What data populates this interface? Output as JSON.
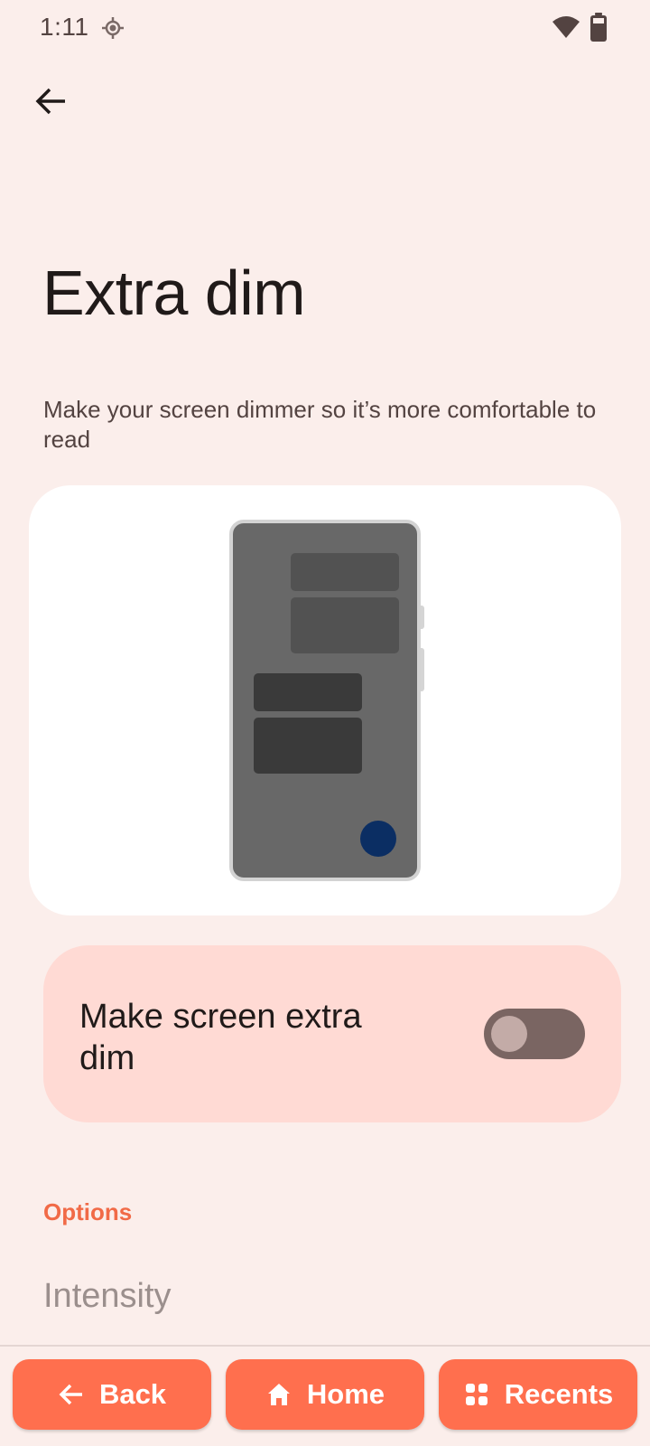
{
  "status_bar": {
    "time": "1:11",
    "icons": [
      "location-icon",
      "wifi-icon",
      "battery-icon"
    ]
  },
  "header": {
    "back_icon": "arrow-left-icon"
  },
  "page": {
    "title": "Extra dim",
    "description": "Make your screen dimmer so it’s more comfortable to read"
  },
  "illustration": {
    "description_icon": "phone-illustration"
  },
  "toggle": {
    "label": "Make screen extra dim",
    "state": "off"
  },
  "options": {
    "section_title": "Options",
    "items": [
      {
        "label": "Intensity",
        "enabled": false
      }
    ]
  },
  "nav": {
    "back_label": "Back",
    "home_label": "Home",
    "recents_label": "Recents"
  },
  "colors": {
    "background": "#FBEEEB",
    "card": "#FFFFFF",
    "toggle_card": "#FFDAD4",
    "accent": "#F16A47",
    "nav_button": "#FF6F4E",
    "switch_track_off": "#7A6562",
    "switch_thumb_off": "#C3ABA7"
  }
}
